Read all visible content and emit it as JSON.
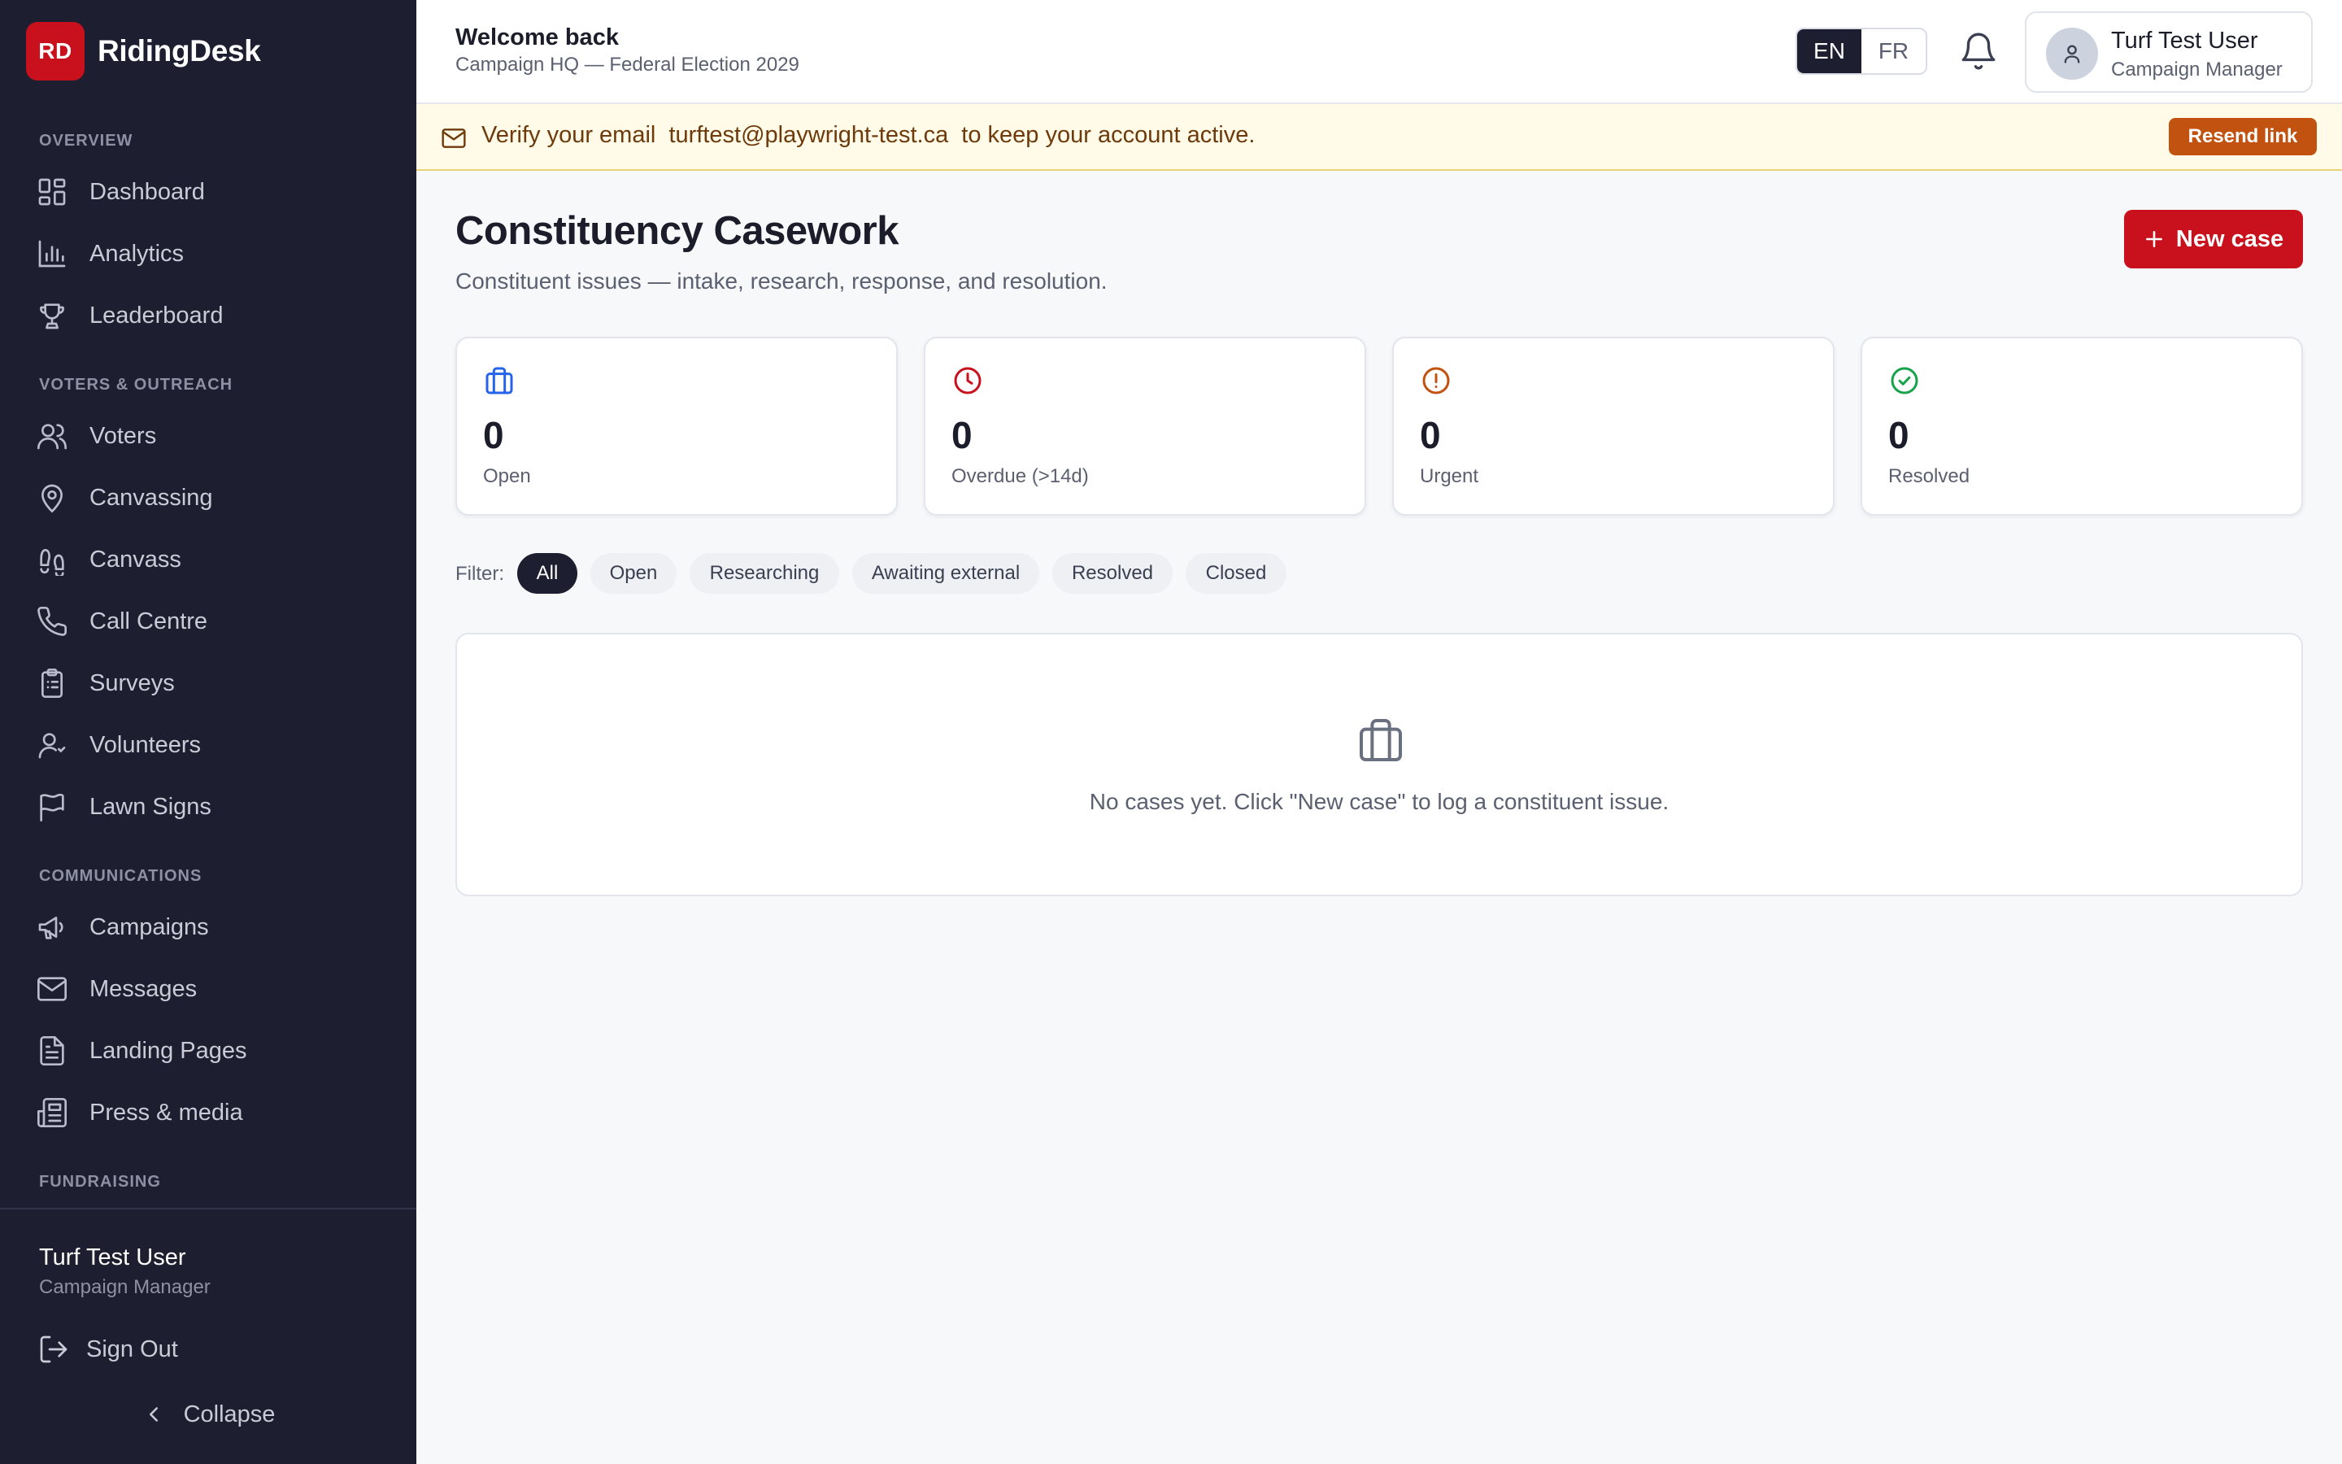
{
  "brand": {
    "logo_text": "RD",
    "name": "RidingDesk"
  },
  "sidebar": {
    "sections": [
      {
        "title": "OVERVIEW"
      },
      {
        "title": "VOTERS & OUTREACH"
      },
      {
        "title": "COMMUNICATIONS"
      },
      {
        "title": "FUNDRAISING"
      }
    ],
    "items": [
      {
        "label": "Dashboard",
        "icon": "dashboard-icon"
      },
      {
        "label": "Analytics",
        "icon": "bar-chart-icon"
      },
      {
        "label": "Leaderboard",
        "icon": "trophy-icon"
      },
      {
        "label": "Voters",
        "icon": "users-icon"
      },
      {
        "label": "Canvassing",
        "icon": "map-pin-icon"
      },
      {
        "label": "Canvass",
        "icon": "footprints-icon"
      },
      {
        "label": "Call Centre",
        "icon": "phone-icon"
      },
      {
        "label": "Surveys",
        "icon": "clipboard-list-icon"
      },
      {
        "label": "Volunteers",
        "icon": "volunteers-icon"
      },
      {
        "label": "Lawn Signs",
        "icon": "flag-icon"
      },
      {
        "label": "Campaigns",
        "icon": "megaphone-icon"
      },
      {
        "label": "Messages",
        "icon": "mail-icon"
      },
      {
        "label": "Landing Pages",
        "icon": "file-text-icon"
      },
      {
        "label": "Press & media",
        "icon": "newspaper-icon"
      }
    ],
    "user": {
      "name": "Turf Test User",
      "role": "Campaign Manager"
    },
    "sign_out": "Sign Out",
    "collapse": "Collapse"
  },
  "header": {
    "welcome": "Welcome back",
    "campaign": "Campaign HQ — Federal Election 2029",
    "lang": {
      "en": "EN",
      "fr": "FR",
      "active": "EN"
    },
    "user": {
      "name": "Turf Test User",
      "role": "Campaign Manager"
    }
  },
  "banner": {
    "text": "Verify your email  turftest@playwright-test.ca  to keep your account active.",
    "button": "Resend link"
  },
  "page": {
    "title": "Constituency Casework",
    "subtitle": "Constituent issues — intake, research, response, and resolution.",
    "new_case": "New case"
  },
  "stats": [
    {
      "value": "0",
      "label": "Open",
      "icon": "briefcase-icon",
      "color": "#2563eb"
    },
    {
      "value": "0",
      "label": "Overdue (>14d)",
      "icon": "clock-icon",
      "color": "#c8111c"
    },
    {
      "value": "0",
      "label": "Urgent",
      "icon": "alert-circle-icon",
      "color": "#c2520f"
    },
    {
      "value": "0",
      "label": "Resolved",
      "icon": "check-circle-icon",
      "color": "#16a34a"
    }
  ],
  "filter": {
    "label": "Filter:",
    "options": [
      "All",
      "Open",
      "Researching",
      "Awaiting external",
      "Resolved",
      "Closed"
    ],
    "selected": "All"
  },
  "empty_state": {
    "icon": "briefcase-icon",
    "text": "No cases yet. Click \"New case\" to log a constituent issue."
  },
  "colors": {
    "sidebar_bg": "#1d1e30",
    "brand_red": "#c8111c",
    "banner_bg": "#fffbe8",
    "resend_orange": "#c2520f"
  }
}
